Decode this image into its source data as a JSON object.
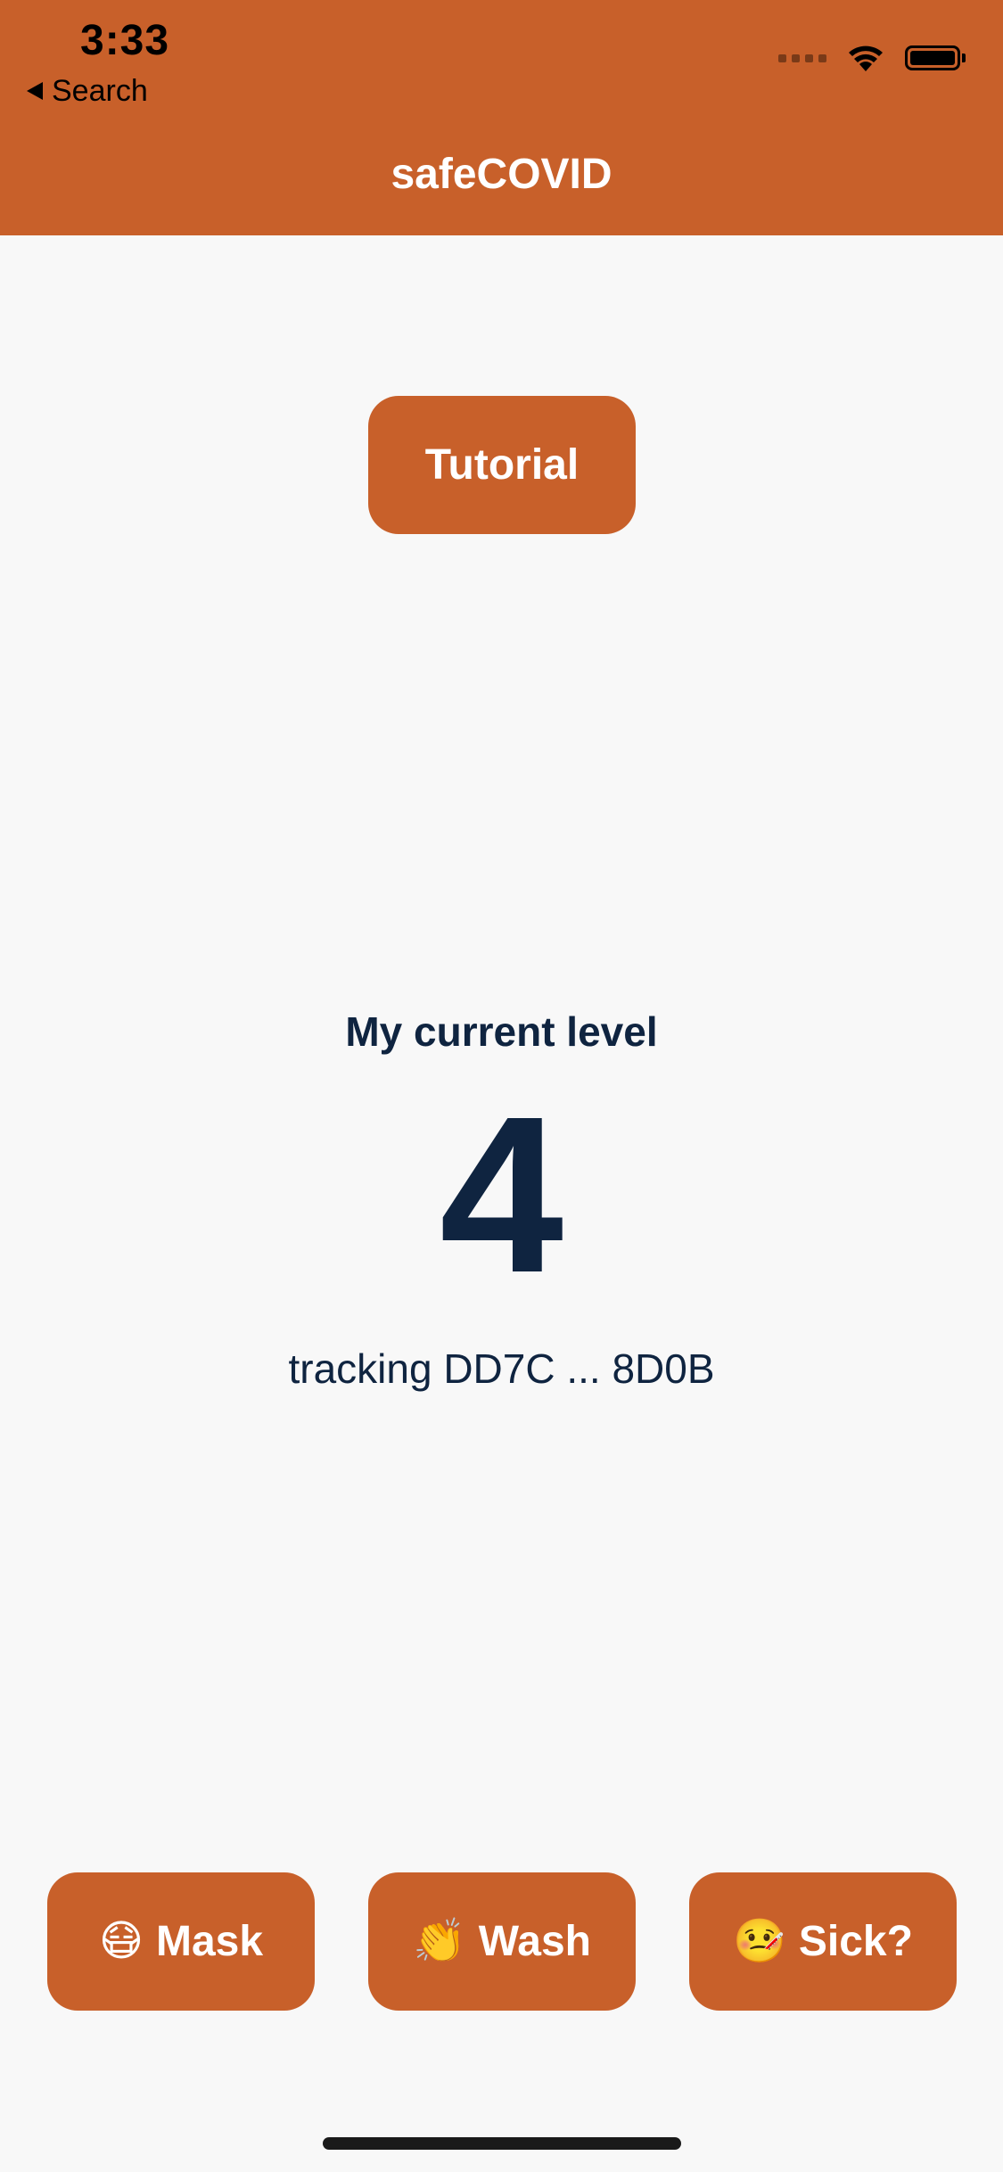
{
  "status_bar": {
    "time": "3:33",
    "back_label": "Search",
    "icons": [
      "signal-icon",
      "wifi-icon",
      "battery-icon"
    ]
  },
  "nav": {
    "title": "safeCOVID"
  },
  "colors": {
    "accent": "#c8602a",
    "text_dark": "#0f2440",
    "background": "#f8f8f8"
  },
  "main": {
    "tutorial_label": "Tutorial",
    "level_label": "My current level",
    "level_value": "4",
    "tracking_text": "tracking DD7C ... 8D0B"
  },
  "actions": [
    {
      "emoji": "😷",
      "label": "Mask"
    },
    {
      "emoji": "👏",
      "label": "Wash"
    },
    {
      "emoji": "🤒",
      "label": "Sick?"
    }
  ]
}
